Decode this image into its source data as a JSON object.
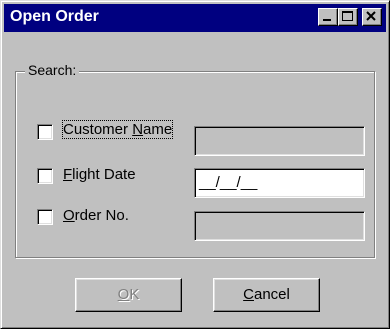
{
  "window": {
    "title": "Open Order",
    "controls": {
      "minimize": "minimize-icon",
      "maximize": "maximize-icon",
      "close": "close-icon"
    }
  },
  "search": {
    "group_label": "Search:",
    "rows": [
      {
        "label_accel": "",
        "label_underlined": "",
        "label_rest": "Customer ",
        "label_underlined2": "N",
        "label_tail": "ame",
        "checked": false,
        "value": "",
        "enabled": false
      },
      {
        "label_accel": "F",
        "label_rest": "light Date",
        "checked": false,
        "value": "__/__/__",
        "enabled": true
      },
      {
        "label_accel": "O",
        "label_rest": "rder No.",
        "checked": false,
        "value": "",
        "enabled": false
      }
    ]
  },
  "buttons": {
    "ok": {
      "accel": "O",
      "rest": "K",
      "enabled": false
    },
    "cancel": {
      "accel": "C",
      "rest": "ancel",
      "enabled": true
    }
  },
  "colors": {
    "titlebar": "#000080",
    "face": "#c0c0c0",
    "field_enabled": "#ffffff"
  }
}
